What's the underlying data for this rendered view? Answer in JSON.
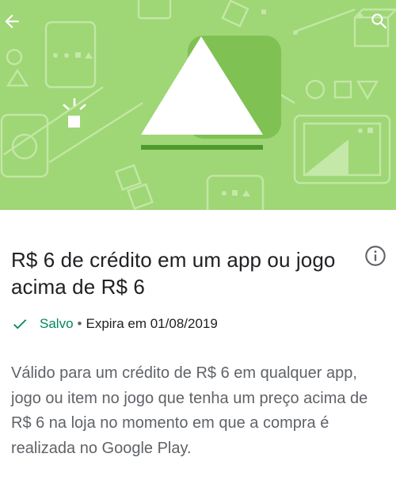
{
  "hero": {
    "background_color": "#9fd676",
    "illustration": "play-store-triangle-illustration"
  },
  "toolbar": {
    "back_icon": "arrow-left-icon",
    "search_icon": "search-icon"
  },
  "offer": {
    "title": "R$ 6 de crédito em um app ou jogo acima de R$ 6",
    "info_icon": "info-icon",
    "status_icon": "check-icon",
    "status_label": "Salvo",
    "separator": "•",
    "expiry_text": "Expira em 01/08/2019",
    "description": "Válido para um crédito de R$ 6 em qualquer app, jogo ou item no jogo que tenha um preço acima de R$ 6 na loja no momento em que a compra é realizada no Google Play."
  },
  "colors": {
    "accent_green": "#01875f",
    "title_text": "#202124",
    "body_text": "#5f6368"
  }
}
